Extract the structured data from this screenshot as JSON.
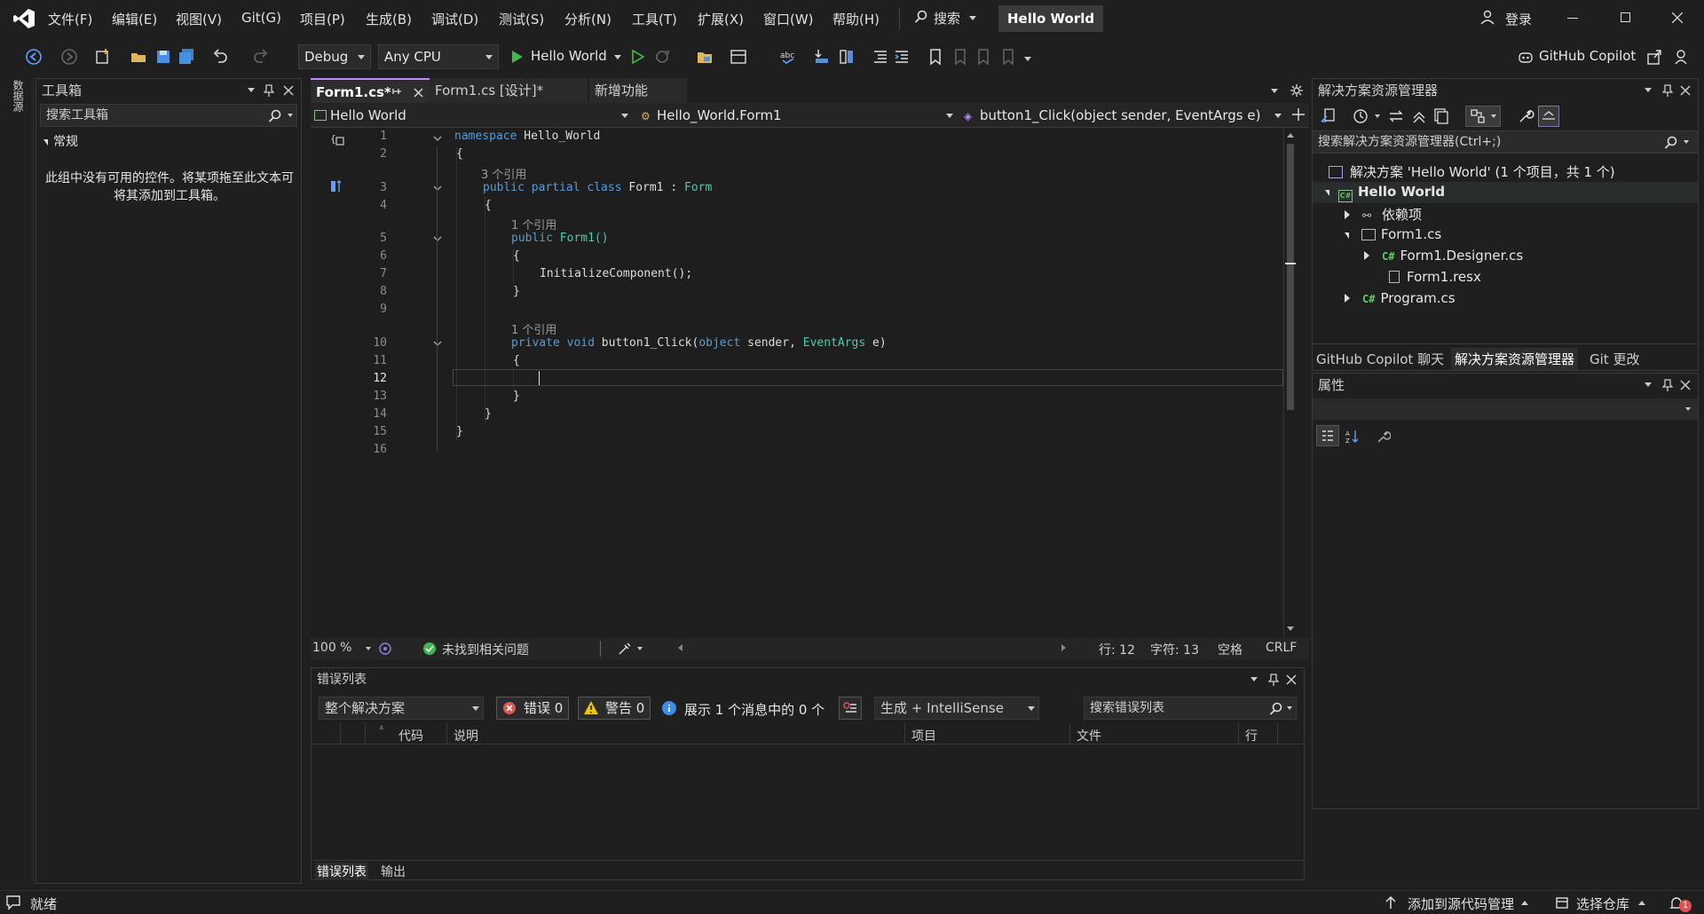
{
  "menu": {
    "items": [
      "文件(F)",
      "编辑(E)",
      "视图(V)",
      "Git(G)",
      "项目(P)",
      "生成(B)",
      "调试(D)",
      "测试(S)",
      "分析(N)",
      "工具(T)",
      "扩展(X)",
      "窗口(W)",
      "帮助(H)"
    ],
    "search_label": "搜索",
    "window_title": "Hello World",
    "login_label": "登录"
  },
  "toolbar": {
    "config": "Debug",
    "platform": "Any CPU",
    "run_label": "Hello World",
    "copilot_label": "GitHub Copilot"
  },
  "left_strip_label": "数据源",
  "toolbox": {
    "title": "工具箱",
    "search_placeholder": "搜索工具箱",
    "group": "常规",
    "empty_message": "此组中没有可用的控件。将某项拖至此文本可将其添加到工具箱。"
  },
  "editor": {
    "tabs": [
      {
        "label": "Form1.cs*",
        "active": true
      },
      {
        "label": "Form1.cs [设计]*",
        "active": false
      },
      {
        "label": "新增功能",
        "active": false
      }
    ],
    "nav": {
      "project": "Hello World",
      "class": "Hello_World.Form1",
      "member": "button1_Click(object sender, EventArgs e)"
    },
    "line_numbers": [
      "1",
      "2",
      "3",
      "4",
      "5",
      "6",
      "7",
      "8",
      "9",
      "10",
      "11",
      "12",
      "13",
      "14",
      "15",
      "16"
    ],
    "references": {
      "class_refs": "3 个引用",
      "ctor_refs": "1 个引用",
      "method_refs": "1 个引用"
    },
    "code": {
      "l1_kw": "namespace",
      "l1_name": " Hello_World",
      "l2": "{",
      "l3_kw": "public partial class",
      "l3_name": " Form1 : ",
      "l3_base": "Form",
      "l4": "{",
      "l5_kw": "public",
      "l5_name": " Form1()",
      "l6": "{",
      "l7": "InitializeComponent();",
      "l8": "}",
      "l10_kw": "private void",
      "l10_name": " button1_Click(",
      "l10_obj": "object",
      "l10_sender": " sender, ",
      "l10_type": "EventArgs",
      "l10_e": " e)",
      "l11": "{",
      "l13": "}",
      "l14": "}",
      "l15": "}"
    },
    "status": {
      "zoom": "100 %",
      "issues": "未找到相关问题",
      "row": "行: 12",
      "col": "字符: 13",
      "whitespace": "空格",
      "eol": "CRLF"
    }
  },
  "error_list": {
    "title": "错误列表",
    "scope": "整个解决方案",
    "errors": "错误 0",
    "warnings": "警告 0",
    "messages": "展示 1 个消息中的 0 个",
    "build_filter": "生成 + IntelliSense",
    "search_placeholder": "搜索错误列表",
    "columns": [
      "代码",
      "说明",
      "项目",
      "文件",
      "行"
    ],
    "bottom_tabs": [
      "错误列表",
      "输出"
    ]
  },
  "solution_explorer": {
    "title": "解决方案资源管理器",
    "search_placeholder": "搜索解决方案资源管理器(Ctrl+;)",
    "solution": "解决方案 'Hello World' (1 个项目，共 1 个)",
    "project": "Hello World",
    "items": [
      "依赖项",
      "Form1.cs",
      "Form1.Designer.cs",
      "Form1.resx",
      "Program.cs"
    ],
    "bottom_tabs": [
      "GitHub Copilot 聊天",
      "解决方案资源管理器",
      "Git 更改"
    ]
  },
  "properties": {
    "title": "属性"
  },
  "statusbar": {
    "ready": "就绪",
    "add_source": "添加到源代码管理",
    "select_repo": "选择仓库",
    "notifications": "1"
  },
  "colors": {
    "accent": "#c285ff",
    "keyword": "#569cd6",
    "type": "#4ec9b0",
    "run_green": "#3fb950",
    "error_red": "#e05252",
    "warning_yellow": "#f0c400"
  }
}
